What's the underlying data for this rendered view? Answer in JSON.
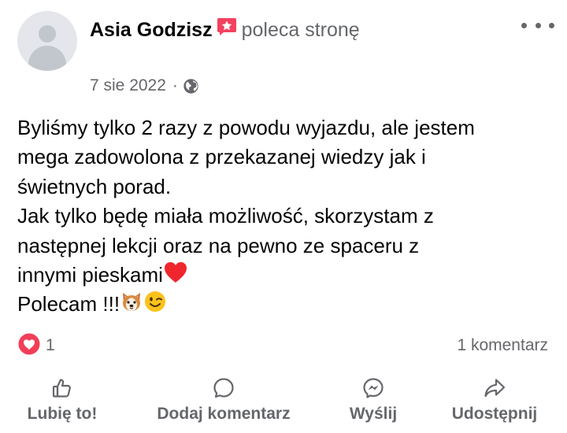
{
  "post": {
    "author_name": "Asia Godzisz",
    "action_text": "poleca stronę",
    "date": "7 sie 2022",
    "meta_separator": "·",
    "privacy_icon": "globe-icon",
    "body_lines": [
      "Byliśmy tylko 2 razy z powodu wyjazdu, ale jestem",
      "mega zadowolona z przekazanej wiedzy jak i",
      "świetnych porad.",
      "Jak tylko będę miała możliwość, skorzystam z",
      "następnej lekcji oraz na pewno ze spaceru z",
      "innymi pieskami",
      "Polecam !!!"
    ],
    "reactions": {
      "icon": "love-reaction-icon",
      "count": "1"
    },
    "comments": "1 komentarz"
  },
  "actions": {
    "like": "Lubię to!",
    "comment": "Dodaj komentarz",
    "send": "Wyślij",
    "share": "Udostępnij"
  },
  "colors": {
    "text": "#050505",
    "secondary": "#65676b",
    "recommend_badge": "#f3425f",
    "love_reaction": "#f33e58"
  }
}
